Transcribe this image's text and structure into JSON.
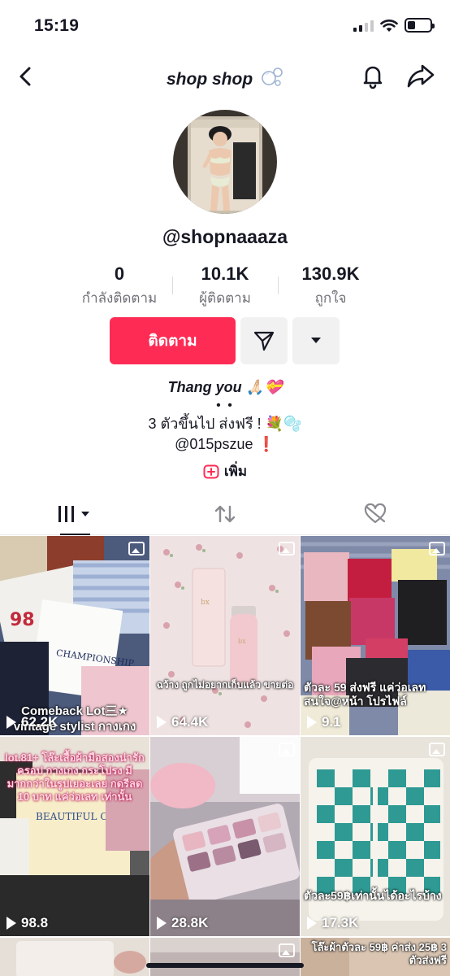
{
  "status": {
    "time": "15:19"
  },
  "header": {
    "title": "shop shop",
    "title_icon": "bubbles-icon"
  },
  "profile": {
    "username": "@shopnaaaza",
    "stats": [
      {
        "value": "0",
        "label": "กำลังติดตาม"
      },
      {
        "value": "10.1K",
        "label": "ผู้ติดตาม"
      },
      {
        "value": "130.9K",
        "label": "ถูกใจ"
      }
    ],
    "follow_label": "ติดตาม",
    "bio": {
      "line1": "Thang you 🙏🏻💝",
      "dots": "• •",
      "line2": "3 ตัวขึ้นไป ส่งฟรี ! 💐🫧",
      "line3": "@015pszue ❗"
    },
    "add_label": "เพิ่ม"
  },
  "colors": {
    "accent": "#fe2c55",
    "text": "#161823",
    "muted": "#6f7077",
    "button_grey": "#f1f1f2"
  },
  "grid": {
    "items": [
      {
        "views": "62.2K",
        "caption": "Comeback Lot三★ vintage stylist กางเกง",
        "theme": "clothes-white-blue"
      },
      {
        "views": "64.4K",
        "caption": "ฉว้าง ถูกไม่อยากเก็บแล้ว ขายต่อ",
        "theme": "skincare-pink"
      },
      {
        "views": "9.1",
        "caption": "ตัวละ 59 ส่งฟรี แค่ว่อเลท สนใจ@หน้า โปรไฟล์",
        "theme": "clothes-colorful"
      },
      {
        "views": "98.8",
        "caption": "lot.81+ โล๊ะเสื้อผ้ามือสองน่ารัก ครอป กางเกง กระโปรง มีมากกว่าในรูปเยอะเลย กดรีลด 10 บาท แค่ว่อเลท เท่านั้น",
        "theme": "clothes-beige"
      },
      {
        "views": "28.8K",
        "caption": "",
        "theme": "palette"
      },
      {
        "views": "17.3K",
        "caption": "ตัวละ59฿เท่านั้นได้อะไรบ้าง",
        "theme": "cardigan"
      },
      {
        "views": "",
        "caption": "",
        "theme": "partial"
      },
      {
        "views": "",
        "caption": "",
        "theme": "partial"
      },
      {
        "views": "",
        "caption": "โล๊ะผ้าตัวละ 59฿ ค่าส่ง 25฿ 3 ตัวส่งฟรี",
        "theme": "partial"
      }
    ]
  }
}
